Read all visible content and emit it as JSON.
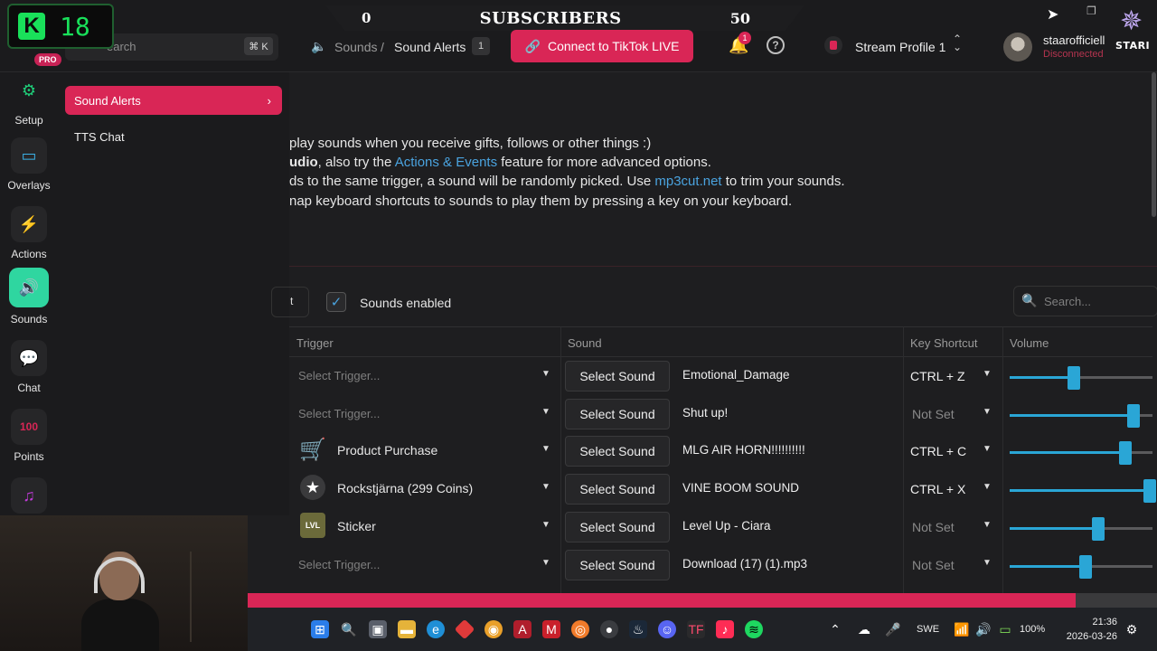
{
  "overlay": {
    "counter_letter": "K",
    "counter_value": "18"
  },
  "badges": {
    "pro": "PRO"
  },
  "search": {
    "placeholder": "earch",
    "shortcut": "⌘ K"
  },
  "subscribers": {
    "left": "0",
    "title": "SUBSCRIBERS",
    "right": "50"
  },
  "breadcrumb": {
    "section": "Sounds",
    "separator": "/",
    "current": "Sound Alerts",
    "count": "1"
  },
  "header": {
    "tiktok_button": "Connect to TikTok LIVE",
    "notification_count": "1",
    "profile_name": "Stream Profile 1",
    "user_name": "staarofficiell",
    "user_status": "Disconnected",
    "brand_text": "STARI"
  },
  "nav": {
    "items": [
      {
        "label": "Setup",
        "icon": "sliders-icon"
      },
      {
        "label": "Overlays",
        "icon": "monitor-icon"
      },
      {
        "label": "Actions",
        "icon": "lightning-icon"
      },
      {
        "label": "Sounds",
        "icon": "speaker-icon"
      },
      {
        "label": "Chat",
        "icon": "chat-icon"
      },
      {
        "label": "Points",
        "icon": "points-icon"
      }
    ]
  },
  "submenu": {
    "active": "Sound Alerts",
    "tts": "TTS Chat"
  },
  "description": {
    "line1": "play sounds when you receive gifts, follows or other things :)",
    "line2_bold": "udio",
    "line2_a": ", also try the ",
    "line2_link": "Actions & Events",
    "line2_b": " feature for more advanced options.",
    "line3_a": "ds to the same trigger, a sound will be randomly picked. Use ",
    "line3_link": "mp3cut.net",
    "line3_b": " to trim your sounds.",
    "line4": "nap keyboard shortcuts to sounds to play them by pressing a key on your keyboard."
  },
  "controls": {
    "partial_button": "t",
    "sounds_enabled_label": "Sounds enabled",
    "search_placeholder": "Search..."
  },
  "table": {
    "headers": {
      "trigger": "Trigger",
      "sound": "Sound",
      "key": "Key Shortcut",
      "volume": "Volume"
    },
    "select_sound_label": "Select Sound",
    "rows": [
      {
        "trigger": "Select Trigger...",
        "trigger_set": false,
        "sound": "Emotional_Damage",
        "key": "CTRL + Z",
        "volume": 45
      },
      {
        "trigger": "Select Trigger...",
        "trigger_set": false,
        "sound": "Shut up!",
        "key": "Not Set",
        "volume": 87
      },
      {
        "trigger": "Product Purchase",
        "trigger_set": true,
        "icon": "cart-icon",
        "sound": "MLG AIR HORN!!!!!!!!!!",
        "key": "CTRL + C",
        "volume": 81
      },
      {
        "trigger": "Rockstjärna (299 Coins)",
        "trigger_set": true,
        "icon": "star-gift-icon",
        "sound": "VINE BOOM SOUND",
        "key": "CTRL + X",
        "volume": 98
      },
      {
        "trigger": "Sticker",
        "trigger_set": true,
        "icon": "levelup-sticker-icon",
        "sound": "Level Up - Ciara",
        "key": "Not Set",
        "volume": 62
      },
      {
        "trigger": "Select Trigger...",
        "trigger_set": false,
        "sound": "Download (17) (1).mp3",
        "key": "Not Set",
        "volume": 53
      }
    ]
  },
  "taskbar": {
    "lang": "SWE",
    "battery": "100%",
    "time": "21:36",
    "date": "2026-03-26"
  },
  "colors": {
    "accent": "#d92656",
    "link": "#4aa3df",
    "slider": "#2aa6d6",
    "counter": "#19e05a"
  }
}
